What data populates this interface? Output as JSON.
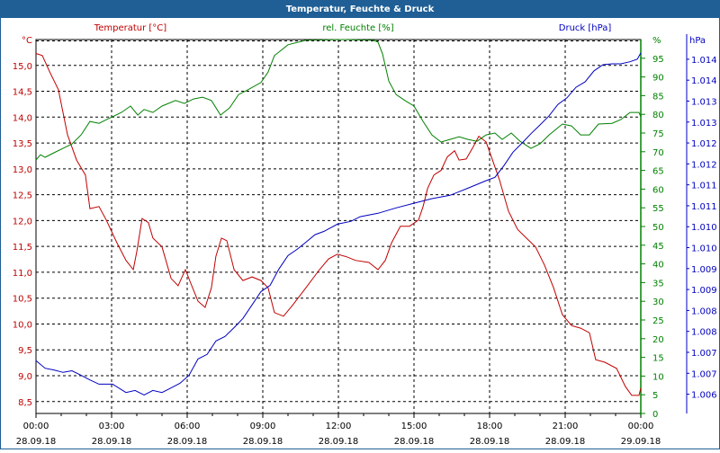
{
  "chart_data": {
    "type": "line",
    "title": "Temperatur, Feuchte & Druck",
    "x_tick_labels": [
      {
        "hour": 0,
        "time": "00:00",
        "date": "28.09.18"
      },
      {
        "hour": 3,
        "time": "03:00",
        "date": "28.09.18"
      },
      {
        "hour": 6,
        "time": "06:00",
        "date": "28.09.18"
      },
      {
        "hour": 9,
        "time": "09:00",
        "date": "28.09.18"
      },
      {
        "hour": 12,
        "time": "12:00",
        "date": "28.09.18"
      },
      {
        "hour": 15,
        "time": "15:00",
        "date": "28.09.18"
      },
      {
        "hour": 18,
        "time": "18:00",
        "date": "28.09.18"
      },
      {
        "hour": 21,
        "time": "21:00",
        "date": "28.09.18"
      },
      {
        "hour": 24,
        "time": "00:00",
        "date": "29.09.18"
      }
    ],
    "xlim": [
      0,
      24
    ],
    "grid": true,
    "axes": {
      "temperature": {
        "label": "Temperatur [°C]",
        "unit": "°C",
        "color": "#c00000",
        "ylim": [
          8.27,
          15.5
        ],
        "ticks": [
          {
            "v": 15.0,
            "t": "15,0"
          },
          {
            "v": 14.5,
            "t": "14,5"
          },
          {
            "v": 14.0,
            "t": "14,0"
          },
          {
            "v": 13.5,
            "t": "13,5"
          },
          {
            "v": 13.0,
            "t": "13,0"
          },
          {
            "v": 12.5,
            "t": "12,5"
          },
          {
            "v": 12.0,
            "t": "12,0"
          },
          {
            "v": 11.5,
            "t": "11,5"
          },
          {
            "v": 11.0,
            "t": "11,0"
          },
          {
            "v": 10.5,
            "t": "10,5"
          },
          {
            "v": 10.0,
            "t": "10,0"
          },
          {
            "v": 9.5,
            "t": "9,5"
          },
          {
            "v": 9.0,
            "t": "9,0"
          },
          {
            "v": 8.5,
            "t": "8,5"
          }
        ]
      },
      "humidity": {
        "label": "rel. Feuchte [%]",
        "unit": "%",
        "color": "#008000",
        "ylim": [
          0,
          100
        ],
        "ticks": [
          "95",
          "90",
          "85",
          "80",
          "75",
          "70",
          "65",
          "60",
          "55",
          "50",
          "45",
          "40",
          "35",
          "30",
          "25",
          "20",
          "15",
          "10",
          "5",
          "0"
        ]
      },
      "pressure": {
        "label": "Druck [hPa]",
        "unit": "hPa",
        "color": "#0000c0",
        "ylim": [
          1005.54,
          1014.47
        ],
        "ticks": [
          {
            "v": 1014.0,
            "t": "1.014"
          },
          {
            "v": 1013.5,
            "t": "1.014"
          },
          {
            "v": 1013.0,
            "t": "1.013"
          },
          {
            "v": 1012.5,
            "t": "1.013"
          },
          {
            "v": 1012.0,
            "t": "1.012"
          },
          {
            "v": 1011.5,
            "t": "1.012"
          },
          {
            "v": 1011.0,
            "t": "1.011"
          },
          {
            "v": 1010.5,
            "t": "1.011"
          },
          {
            "v": 1010.0,
            "t": "1.010"
          },
          {
            "v": 1009.5,
            "t": "1.010"
          },
          {
            "v": 1009.0,
            "t": "1.009"
          },
          {
            "v": 1008.5,
            "t": "1.009"
          },
          {
            "v": 1008.0,
            "t": "1.008"
          },
          {
            "v": 1007.5,
            "t": "1.008"
          },
          {
            "v": 1007.0,
            "t": "1.007"
          },
          {
            "v": 1006.5,
            "t": "1.007"
          },
          {
            "v": 1006.0,
            "t": "1.006"
          }
        ]
      }
    },
    "series": [
      {
        "name": "Temperatur [°C]",
        "axis": "temperature",
        "color": "#c00000",
        "points": [
          [
            0,
            15.23
          ],
          [
            0.25,
            15.19
          ],
          [
            0.54,
            14.88
          ],
          [
            0.89,
            14.53
          ],
          [
            1.25,
            13.66
          ],
          [
            1.61,
            13.17
          ],
          [
            1.96,
            12.88
          ],
          [
            2.14,
            12.23
          ],
          [
            2.5,
            12.27
          ],
          [
            2.79,
            12.01
          ],
          [
            3.21,
            11.57
          ],
          [
            3.57,
            11.23
          ],
          [
            3.86,
            11.05
          ],
          [
            4.0,
            11.4
          ],
          [
            4.21,
            12.04
          ],
          [
            4.46,
            11.96
          ],
          [
            4.64,
            11.66
          ],
          [
            5.0,
            11.49
          ],
          [
            5.36,
            10.88
          ],
          [
            5.64,
            10.74
          ],
          [
            5.93,
            11.05
          ],
          [
            6.14,
            10.79
          ],
          [
            6.43,
            10.44
          ],
          [
            6.71,
            10.32
          ],
          [
            6.96,
            10.7
          ],
          [
            7.14,
            11.31
          ],
          [
            7.36,
            11.66
          ],
          [
            7.57,
            11.61
          ],
          [
            7.86,
            11.05
          ],
          [
            8.21,
            10.84
          ],
          [
            8.57,
            10.91
          ],
          [
            8.93,
            10.84
          ],
          [
            9.21,
            10.7
          ],
          [
            9.46,
            10.22
          ],
          [
            9.82,
            10.15
          ],
          [
            10.18,
            10.36
          ],
          [
            10.71,
            10.7
          ],
          [
            11.25,
            11.05
          ],
          [
            11.61,
            11.26
          ],
          [
            11.96,
            11.35
          ],
          [
            12.32,
            11.3
          ],
          [
            12.68,
            11.23
          ],
          [
            13.21,
            11.19
          ],
          [
            13.57,
            11.05
          ],
          [
            13.86,
            11.23
          ],
          [
            14.11,
            11.57
          ],
          [
            14.46,
            11.89
          ],
          [
            14.82,
            11.89
          ],
          [
            15.18,
            12.01
          ],
          [
            15.36,
            12.27
          ],
          [
            15.54,
            12.62
          ],
          [
            15.79,
            12.88
          ],
          [
            16.07,
            12.97
          ],
          [
            16.32,
            13.23
          ],
          [
            16.61,
            13.35
          ],
          [
            16.79,
            13.17
          ],
          [
            17.07,
            13.19
          ],
          [
            17.32,
            13.4
          ],
          [
            17.57,
            13.63
          ],
          [
            17.86,
            13.52
          ],
          [
            18.07,
            13.23
          ],
          [
            18.39,
            12.79
          ],
          [
            18.75,
            12.18
          ],
          [
            19.11,
            11.83
          ],
          [
            19.46,
            11.66
          ],
          [
            19.82,
            11.49
          ],
          [
            20.18,
            11.14
          ],
          [
            20.54,
            10.7
          ],
          [
            20.89,
            10.18
          ],
          [
            21.25,
            9.97
          ],
          [
            21.61,
            9.92
          ],
          [
            21.96,
            9.83
          ],
          [
            22.21,
            9.31
          ],
          [
            22.57,
            9.26
          ],
          [
            23.04,
            9.14
          ],
          [
            23.39,
            8.79
          ],
          [
            23.64,
            8.62
          ],
          [
            23.93,
            8.62
          ],
          [
            24.0,
            8.76
          ]
        ]
      },
      {
        "name": "rel. Feuchte [%]",
        "axis": "humidity",
        "color": "#008000",
        "points": [
          [
            0,
            67.8
          ],
          [
            0.18,
            69.2
          ],
          [
            0.36,
            68.5
          ],
          [
            0.71,
            69.7
          ],
          [
            1.07,
            70.9
          ],
          [
            1.43,
            72.1
          ],
          [
            1.79,
            74.5
          ],
          [
            2.14,
            78.1
          ],
          [
            2.5,
            77.6
          ],
          [
            2.86,
            78.8
          ],
          [
            3.39,
            80.5
          ],
          [
            3.75,
            82.2
          ],
          [
            4.04,
            79.8
          ],
          [
            4.29,
            81.3
          ],
          [
            4.64,
            80.5
          ],
          [
            5.0,
            82.2
          ],
          [
            5.54,
            83.7
          ],
          [
            5.89,
            82.9
          ],
          [
            6.25,
            84.1
          ],
          [
            6.61,
            84.6
          ],
          [
            6.96,
            83.7
          ],
          [
            7.32,
            79.8
          ],
          [
            7.68,
            81.7
          ],
          [
            8.04,
            85.3
          ],
          [
            8.39,
            86.5
          ],
          [
            8.93,
            88.5
          ],
          [
            9.21,
            91.3
          ],
          [
            9.46,
            95.7
          ],
          [
            10.0,
            98.6
          ],
          [
            10.71,
            99.8
          ],
          [
            12.14,
            100
          ],
          [
            13.39,
            99.8
          ],
          [
            13.57,
            99.3
          ],
          [
            13.75,
            96.2
          ],
          [
            14.0,
            88.9
          ],
          [
            14.29,
            85.3
          ],
          [
            14.64,
            83.7
          ],
          [
            15.0,
            82.2
          ],
          [
            15.36,
            78.1
          ],
          [
            15.71,
            74.5
          ],
          [
            16.07,
            72.6
          ],
          [
            16.43,
            73.3
          ],
          [
            16.79,
            74.0
          ],
          [
            17.14,
            73.3
          ],
          [
            17.5,
            72.8
          ],
          [
            17.86,
            74.5
          ],
          [
            18.21,
            75.0
          ],
          [
            18.5,
            73.3
          ],
          [
            18.86,
            75.0
          ],
          [
            19.21,
            72.8
          ],
          [
            19.64,
            70.9
          ],
          [
            20.0,
            72.1
          ],
          [
            20.36,
            74.5
          ],
          [
            20.89,
            77.4
          ],
          [
            21.25,
            76.9
          ],
          [
            21.61,
            74.5
          ],
          [
            21.96,
            74.5
          ],
          [
            22.32,
            77.4
          ],
          [
            22.86,
            77.6
          ],
          [
            23.21,
            78.6
          ],
          [
            23.57,
            80.5
          ],
          [
            23.93,
            80.5
          ],
          [
            24.0,
            79.3
          ]
        ]
      },
      {
        "name": "Druck [hPa]",
        "axis": "pressure",
        "color": "#0000c0",
        "points": [
          [
            0,
            1006.8
          ],
          [
            0.36,
            1006.62
          ],
          [
            0.71,
            1006.58
          ],
          [
            1.07,
            1006.52
          ],
          [
            1.43,
            1006.56
          ],
          [
            1.79,
            1006.45
          ],
          [
            2.14,
            1006.34
          ],
          [
            2.5,
            1006.24
          ],
          [
            3.04,
            1006.24
          ],
          [
            3.57,
            1006.04
          ],
          [
            3.93,
            1006.09
          ],
          [
            4.29,
            1005.98
          ],
          [
            4.64,
            1006.09
          ],
          [
            5.0,
            1006.04
          ],
          [
            5.36,
            1006.15
          ],
          [
            5.71,
            1006.26
          ],
          [
            6.07,
            1006.45
          ],
          [
            6.43,
            1006.84
          ],
          [
            6.79,
            1006.95
          ],
          [
            7.14,
            1007.27
          ],
          [
            7.5,
            1007.38
          ],
          [
            7.86,
            1007.59
          ],
          [
            8.21,
            1007.81
          ],
          [
            8.57,
            1008.13
          ],
          [
            8.93,
            1008.45
          ],
          [
            9.29,
            1008.6
          ],
          [
            9.64,
            1008.99
          ],
          [
            10.0,
            1009.31
          ],
          [
            10.36,
            1009.46
          ],
          [
            10.71,
            1009.63
          ],
          [
            11.07,
            1009.81
          ],
          [
            11.43,
            1009.89
          ],
          [
            11.96,
            1010.06
          ],
          [
            12.5,
            1010.13
          ],
          [
            12.86,
            1010.24
          ],
          [
            13.57,
            1010.32
          ],
          [
            14.29,
            1010.45
          ],
          [
            15.0,
            1010.56
          ],
          [
            15.71,
            1010.67
          ],
          [
            16.43,
            1010.75
          ],
          [
            17.14,
            1010.92
          ],
          [
            17.86,
            1011.1
          ],
          [
            18.21,
            1011.18
          ],
          [
            18.57,
            1011.46
          ],
          [
            18.93,
            1011.78
          ],
          [
            19.29,
            1012.0
          ],
          [
            19.64,
            1012.22
          ],
          [
            20.0,
            1012.43
          ],
          [
            20.36,
            1012.65
          ],
          [
            20.71,
            1012.92
          ],
          [
            21.07,
            1013.08
          ],
          [
            21.43,
            1013.33
          ],
          [
            21.79,
            1013.46
          ],
          [
            22.14,
            1013.72
          ],
          [
            22.5,
            1013.87
          ],
          [
            22.86,
            1013.89
          ],
          [
            23.21,
            1013.89
          ],
          [
            23.57,
            1013.94
          ],
          [
            23.86,
            1014.0
          ],
          [
            24.0,
            1014.15
          ]
        ]
      }
    ]
  }
}
